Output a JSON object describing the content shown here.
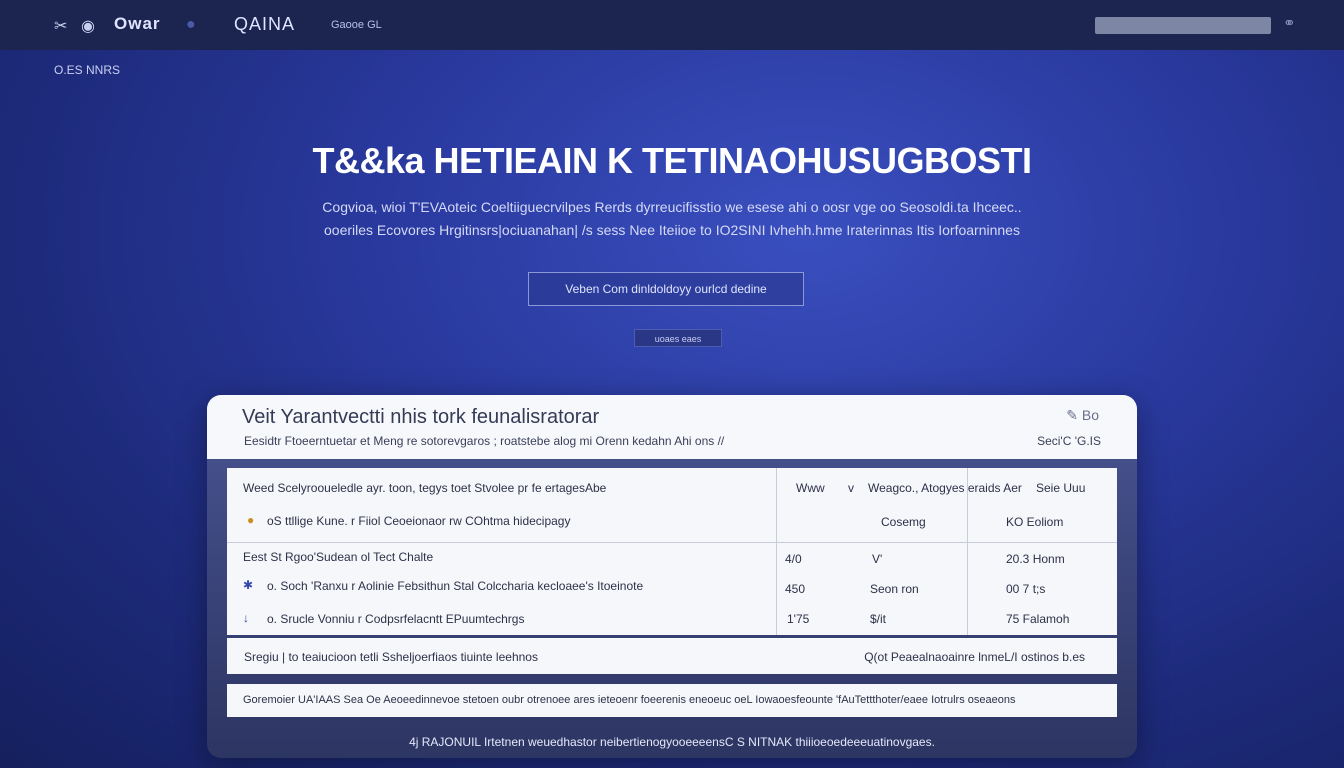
{
  "topbar": {
    "icon_left_1": "✂",
    "icon_left_2": "◉",
    "logo_text": "Owar",
    "icon_left_3": "●",
    "brand": "QAINA",
    "small_link": "Gaooe GL",
    "search_value": "",
    "user_icon": "⚭"
  },
  "breadcrumb": "O.ES NNRS",
  "hero": {
    "title": "T&&ka HETIEAIN  K TETINAOHUSUGBOSTI",
    "subtitle_1": "Cogvioa, wioi T'EVAoteic Coeltiiguecrvilpes Rerds dyrreucifisstio we esese ahi o oosr vge oo Seosoldi.ta Ihceec..",
    "subtitle_2": "ooeriles Ecovores Hrgitinsrs|ociuanahan| /s sess Nee Iteiioe to IO2SINI Ivhehh.hme Iraterinnas Itis Iorfoarninnes",
    "cta_label": "Veben Com dinldoldoyy ourlcd dedine",
    "pill": "uoaes eaes"
  },
  "card": {
    "title": "Veit Yarantvectti nhis tork feunalisratorar",
    "description": "Eesidtr Ftoeerntuetar et Meng re sotorevgaros  ; roatstebe alog mi Orenn kedahn  Ahi ons //",
    "icon": "✎ Bo",
    "meta": "Seci'C 'G.IS",
    "table": {
      "header_c1": "Weed Scelyrooueledle ayr. toon, tegys toet Stvolee pr fe ertagesAbe",
      "header_c2a": "Www",
      "header_c2b": "v",
      "header_c3": "Weagco., Atogyes eraids Aer",
      "header_c4": "Seie Uuu",
      "row0_c1": "oS  ttllige Kune. r  Fiiol Ceoeionaor  rw COhtma hidecipagy",
      "row0_c3": "Cosemg",
      "row0_c4": "KO Eoliom",
      "group_label": "Eest St  Rgoo'Sudean ol Tect Chalte",
      "row1_c1": "o. Soch 'Ranxu  r  Aolinie Febsithun  Stal Colccharia kecloaee's Itoeinote",
      "row1_c2": "4/0",
      "row1_c3": "V'",
      "row1_c4": "20.3 Honm",
      "row2_c1": "o. Srucle Vonniu  r  Codpsrfelacntt  EPuumtechrgs",
      "row2_c2": "450",
      "row2_c3": "Seon ron",
      "row2_c4": "00 7 t;s",
      "row3_c2": "1'75",
      "row3_c3": "$/it",
      "row3_c4": "75 Falamoh"
    },
    "bar1_left": "Sregiu | to teaiucioon tetli Ssheljoerfiaos tiuinte leehnos",
    "bar1_right": "Q(ot Peaealnaoainre lnmeL/I ostinos b.es",
    "bar2_text": "Goremoier UA'IAAS Sea Oe Aeoeedinnevoe stetoen oubr otrenoee ares ieteoenr foeerenis eneoeuc oeL Iowaoesfeounte 'fAuTettthoter/eaee Iotrulrs oseaeons",
    "footnote": "4j RAJONUIL Irtetnen weuedhastor neibertienogyooeeeensC S NITNAK thiiioeoedeeeuatinovgaes."
  },
  "colors": {
    "bg_top": "#1c2450",
    "hero_bg": "#2a3aa0",
    "card_panel": "#f6f7fb",
    "accent_marker": "#3547a8"
  }
}
